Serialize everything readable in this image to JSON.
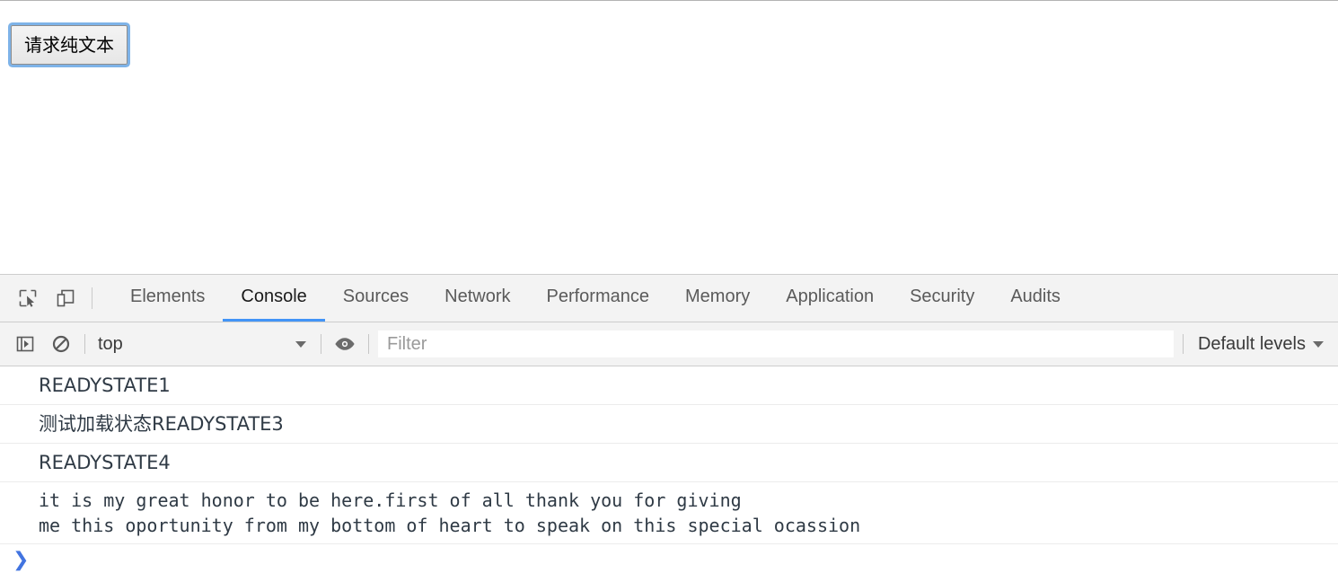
{
  "page": {
    "button_label": "请求纯文本"
  },
  "devtools": {
    "toolbar_icons": [
      {
        "name": "inspect-element-icon",
        "title": "Inspect"
      },
      {
        "name": "device-toolbar-icon",
        "title": "Toggle device toolbar"
      }
    ],
    "tabs": [
      {
        "label": "Elements",
        "active": false
      },
      {
        "label": "Console",
        "active": true
      },
      {
        "label": "Sources",
        "active": false
      },
      {
        "label": "Network",
        "active": false
      },
      {
        "label": "Performance",
        "active": false
      },
      {
        "label": "Memory",
        "active": false
      },
      {
        "label": "Application",
        "active": false
      },
      {
        "label": "Security",
        "active": false
      },
      {
        "label": "Audits",
        "active": false
      }
    ],
    "console_toolbar": {
      "sidebar_icon": "show-console-sidebar-icon",
      "clear_icon": "clear-console-icon",
      "context_value": "top",
      "eye_icon": "live-expression-eye-icon",
      "filter_value": "",
      "filter_placeholder": "Filter",
      "levels_value": "Default levels"
    },
    "messages": [
      {
        "text": "READYSTATE1",
        "mono": false
      },
      {
        "text": "测试加载状态READYSTATE3",
        "mono": false
      },
      {
        "text": "READYSTATE4",
        "mono": false
      },
      {
        "text": "it is my great honor to be here.first of all thank you for giving\nme this oportunity from my bottom of heart to speak on this special ocassion",
        "mono": true
      }
    ],
    "prompt_caret": "❯"
  },
  "colors": {
    "accent_blue": "#4294f7",
    "prompt_blue": "#4274e0",
    "toolbar_bg": "#f3f3f3",
    "border": "#cdcdcd"
  }
}
